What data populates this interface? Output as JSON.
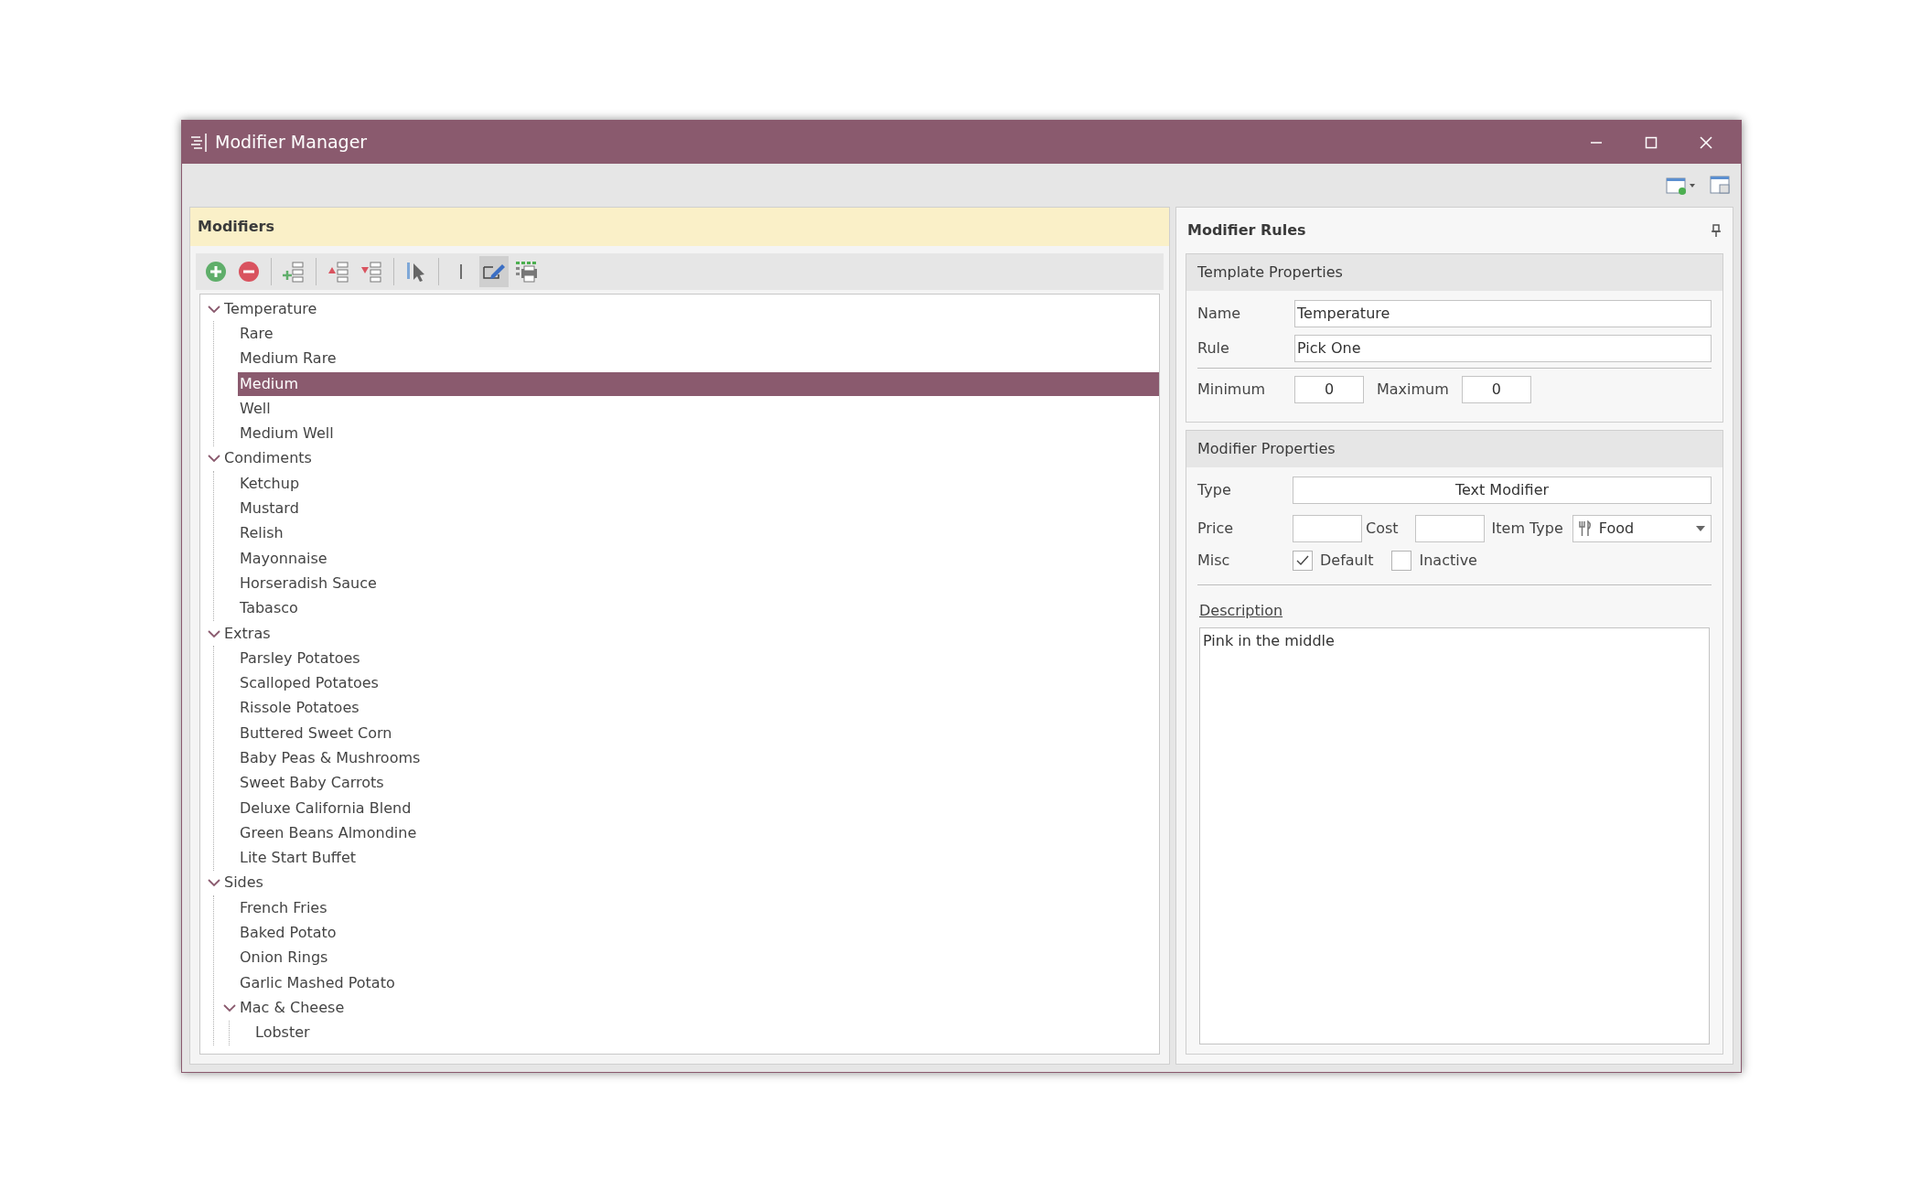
{
  "window": {
    "title": "Modifier Manager"
  },
  "modifiers_panel": {
    "title": "Modifiers",
    "edit_mode": true,
    "tree": [
      {
        "label": "Temperature",
        "selected": false,
        "expanded": true,
        "children": [
          {
            "label": "Rare",
            "selected": false
          },
          {
            "label": "Medium Rare",
            "selected": false
          },
          {
            "label": "Medium",
            "selected": true
          },
          {
            "label": "Well",
            "selected": false
          },
          {
            "label": "Medium Well",
            "selected": false
          }
        ]
      },
      {
        "label": "Condiments",
        "selected": false,
        "expanded": true,
        "children": [
          {
            "label": "Ketchup",
            "selected": false
          },
          {
            "label": "Mustard",
            "selected": false
          },
          {
            "label": "Relish",
            "selected": false
          },
          {
            "label": "Mayonnaise",
            "selected": false
          },
          {
            "label": "Horseradish Sauce",
            "selected": false
          },
          {
            "label": "Tabasco",
            "selected": false
          }
        ]
      },
      {
        "label": "Extras",
        "selected": false,
        "expanded": true,
        "children": [
          {
            "label": "Parsley Potatoes",
            "selected": false
          },
          {
            "label": "Scalloped Potatoes",
            "selected": false
          },
          {
            "label": "Rissole Potatoes",
            "selected": false
          },
          {
            "label": "Buttered Sweet Corn",
            "selected": false
          },
          {
            "label": "Baby Peas & Mushrooms",
            "selected": false
          },
          {
            "label": "Sweet Baby Carrots",
            "selected": false
          },
          {
            "label": "Deluxe California Blend",
            "selected": false
          },
          {
            "label": "Green Beans Almondine",
            "selected": false
          },
          {
            "label": "Lite Start Buffet",
            "selected": false
          }
        ]
      },
      {
        "label": "Sides",
        "selected": false,
        "expanded": true,
        "children": [
          {
            "label": "French Fries",
            "selected": false
          },
          {
            "label": "Baked Potato",
            "selected": false
          },
          {
            "label": "Onion Rings",
            "selected": false
          },
          {
            "label": "Garlic Mashed Potato",
            "selected": false
          },
          {
            "label": "Mac & Cheese",
            "selected": false,
            "expanded": true,
            "children": [
              {
                "label": "Lobster",
                "selected": false
              }
            ]
          }
        ]
      }
    ]
  },
  "rules_panel": {
    "title": "Modifier Rules",
    "template_properties": {
      "title": "Template Properties",
      "name_label": "Name",
      "name_value": "Temperature",
      "rule_label": "Rule",
      "rule_value": "Pick One",
      "minimum_label": "Minimum",
      "minimum_value": "0",
      "maximum_label": "Maximum",
      "maximum_value": "0"
    },
    "modifier_properties": {
      "title": "Modifier Properties",
      "type_label": "Type",
      "type_value": "Text Modifier",
      "price_label": "Price",
      "cost_label": "Cost",
      "item_type_label": "Item Type",
      "item_type_value": "Food",
      "misc_label": "Misc",
      "checkboxes": [
        {
          "label": "Default",
          "checked": true
        },
        {
          "label": "Inactive",
          "checked": false
        }
      ],
      "description_label": "Description",
      "description_value": "Pink in the middle"
    }
  }
}
